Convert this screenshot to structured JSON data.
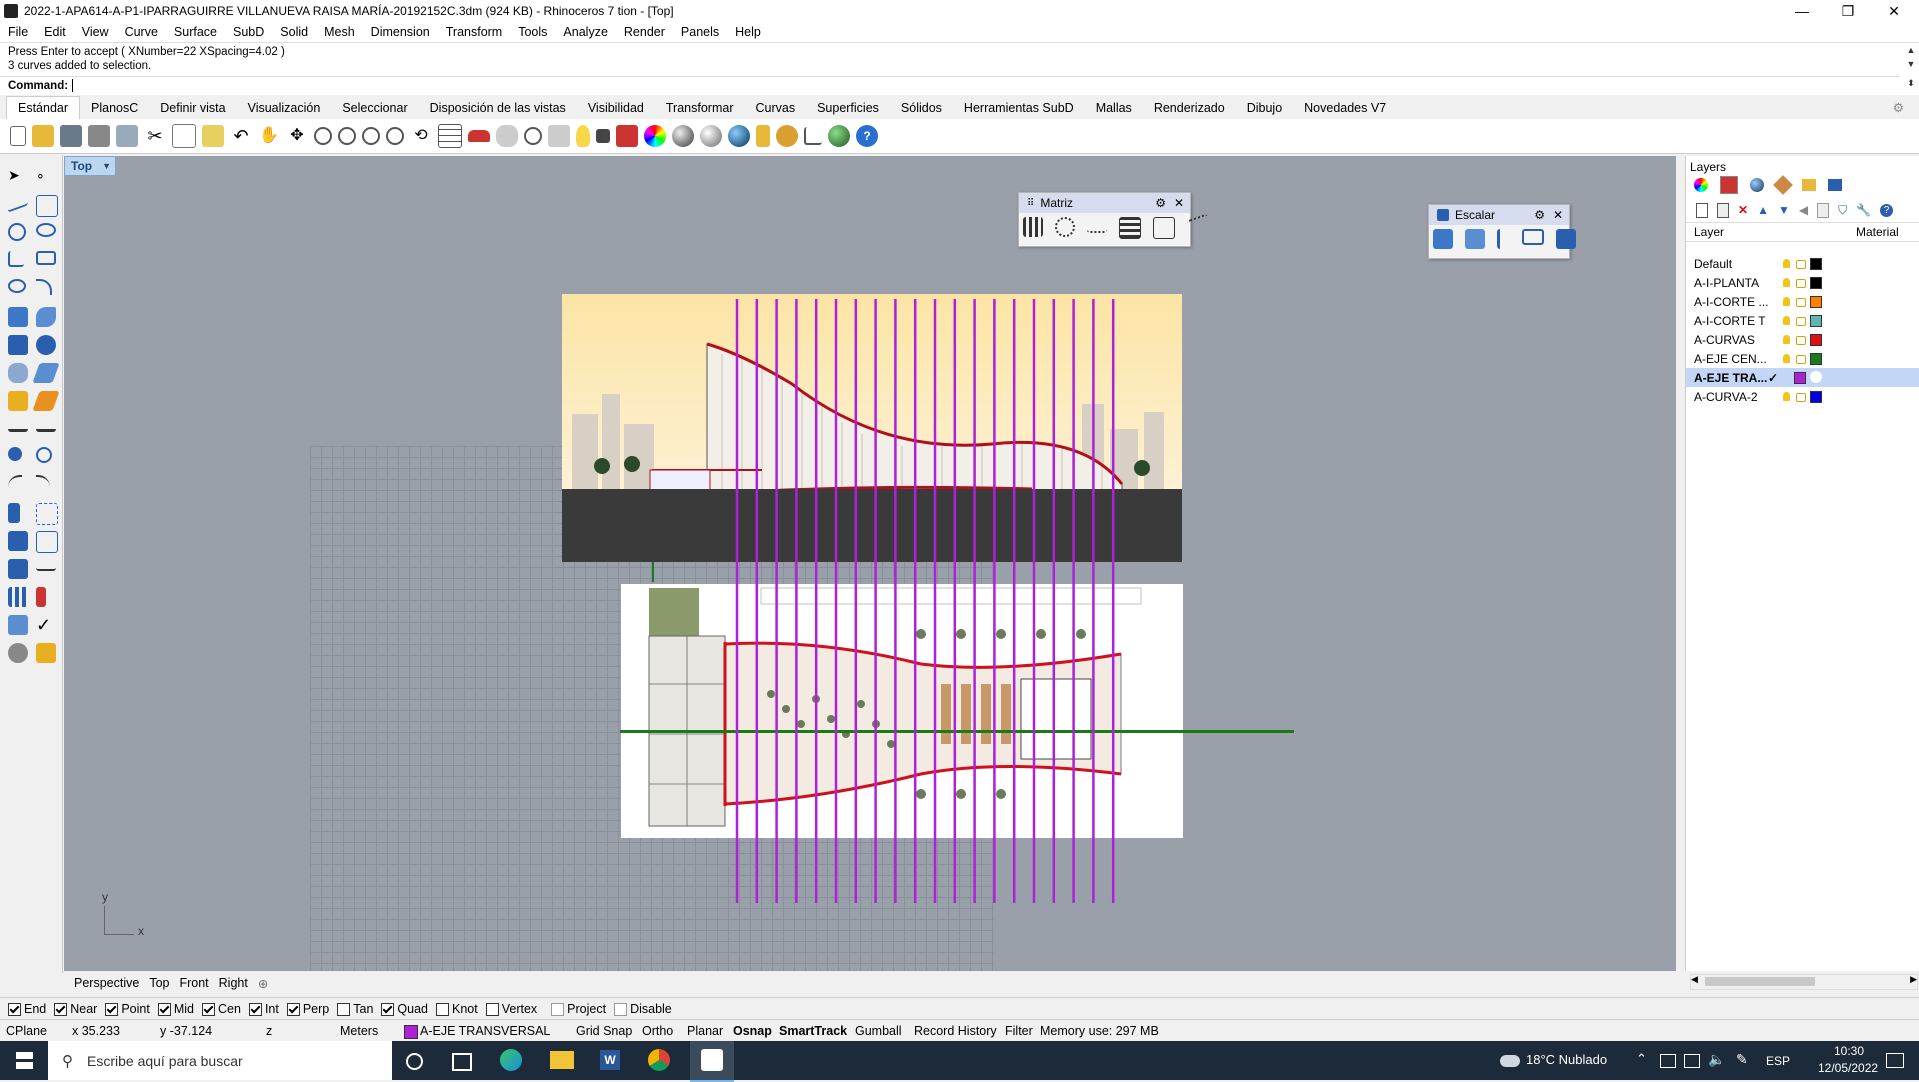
{
  "window": {
    "title": "2022-1-APA614-A-P1-IPARRAGUIRRE VILLANUEVA RAISA MARÍA-20192152C.3dm (924 KB) - Rhinoceros 7 tion - [Top]",
    "min": "—",
    "max": "❐",
    "close": "✕"
  },
  "menu": [
    "File",
    "Edit",
    "View",
    "Curve",
    "Surface",
    "SubD",
    "Solid",
    "Mesh",
    "Dimension",
    "Transform",
    "Tools",
    "Analyze",
    "Render",
    "Panels",
    "Help"
  ],
  "command": {
    "history1": "Press Enter to accept ( XNumber=22  XSpacing=4.02 )",
    "history2": "3 curves added to selection.",
    "prompt": "Command:",
    "value": ""
  },
  "tabs": [
    "Estándar",
    "PlanosC",
    "Definir vista",
    "Visualización",
    "Seleccionar",
    "Disposición de las vistas",
    "Visibilidad",
    "Transformar",
    "Curvas",
    "Superficies",
    "Sólidos",
    "Herramientas SubD",
    "Mallas",
    "Renderizado",
    "Dibujo",
    "Novedades V7"
  ],
  "viewport": {
    "name": "Top",
    "axis_y": "y",
    "axis_x": "x"
  },
  "panels": {
    "matriz": {
      "title": "Matriz"
    },
    "escalar": {
      "title": "Escalar"
    }
  },
  "viewport_tabs": [
    "Perspective",
    "Top",
    "Front",
    "Right"
  ],
  "osnaps": [
    {
      "label": "End",
      "checked": true
    },
    {
      "label": "Near",
      "checked": true
    },
    {
      "label": "Point",
      "checked": true
    },
    {
      "label": "Mid",
      "checked": true
    },
    {
      "label": "Cen",
      "checked": true
    },
    {
      "label": "Int",
      "checked": true
    },
    {
      "label": "Perp",
      "checked": true
    },
    {
      "label": "Tan",
      "checked": false
    },
    {
      "label": "Quad",
      "checked": true
    },
    {
      "label": "Knot",
      "checked": false
    },
    {
      "label": "Vertex",
      "checked": false
    },
    {
      "label": "Project",
      "checked": false
    },
    {
      "label": "Disable",
      "checked": false
    }
  ],
  "status": {
    "cplane": "CPlane",
    "x": "x 35.233",
    "y": "y -37.124",
    "z": "z",
    "units": "Meters",
    "layer": "A-EJE TRANSVERSAL",
    "grid_snap": "Grid Snap",
    "ortho": "Ortho",
    "planar": "Planar",
    "osnap": "Osnap",
    "smarttrack": "SmartTrack",
    "gumball": "Gumball",
    "record_history": "Record History",
    "filter": "Filter",
    "memory": "Memory use: 297 MB"
  },
  "layers_panel": {
    "title": "Layers",
    "col_layer": "Layer",
    "col_material": "Material",
    "layers": [
      {
        "name": "Default",
        "color": "#000000",
        "current": false
      },
      {
        "name": "A-I-PLANTA",
        "color": "#000000",
        "current": false
      },
      {
        "name": "A-I-CORTE ...",
        "color": "#ff7f00",
        "current": false
      },
      {
        "name": "A-I-CORTE T",
        "color": "#5fb8b0",
        "current": false
      },
      {
        "name": "A-CURVAS",
        "color": "#e01010",
        "current": false
      },
      {
        "name": "A-EJE CEN...",
        "color": "#1a7a1a",
        "current": false
      },
      {
        "name": "A-EJE TRA...",
        "color": "#b020d8",
        "current": true
      },
      {
        "name": "A-CURVA-2",
        "color": "#0000e0",
        "current": false
      }
    ]
  },
  "taskbar": {
    "search_placeholder": "Escribe aquí para buscar",
    "weather": "18°C  Nublado",
    "lang": "ESP",
    "time": "10:30",
    "date": "12/05/2022"
  },
  "colors": {
    "viewport_bg": "#9aa0aa",
    "magenta_lines": "#b020d8",
    "red_curves": "#d0101a",
    "green_axis": "#1a7a1a"
  }
}
